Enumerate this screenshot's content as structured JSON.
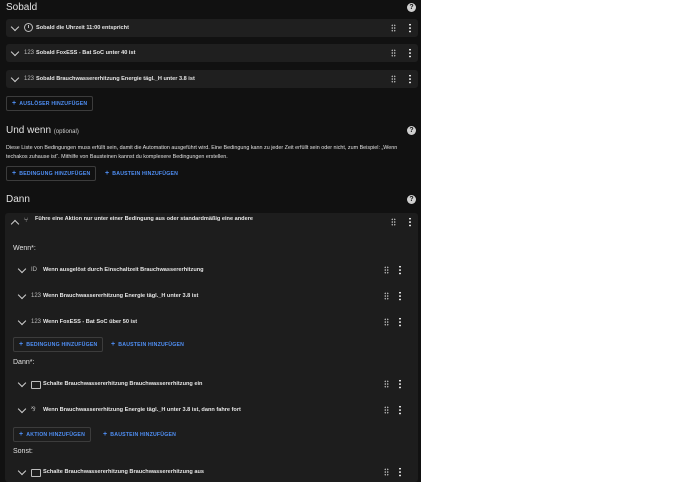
{
  "sobald": {
    "title": "Sobald",
    "help_icon": "?",
    "triggers": [
      {
        "icon": "clock-icon",
        "label": "Sobald die Uhrzeit 11:00 entspricht"
      },
      {
        "icon": "numeric-icon",
        "icon_text": "123",
        "label": "Sobald FoxESS - Bat SoC unter 40 ist"
      },
      {
        "icon": "numeric-icon",
        "icon_text": "123",
        "label": "Sobald Brauchwassererhitzung Energie tägl._H unter 3.8 ist"
      }
    ],
    "add_label": "AUSLÖSER HINZUFÜGEN"
  },
  "und_wenn": {
    "title": "Und wenn",
    "optional": "(optional)",
    "help_icon": "?",
    "description": "Diese Liste von Bedingungen muss erfüllt sein, damit die Automation ausgeführt wird. Eine Bedingung kann zu jeder Zeit erfüllt sein oder nicht, zum Beispiel: „Wenn techakos zuhause ist“. Mithilfe von Bausteinen kannst du komplexere Bedingungen erstellen.",
    "add_condition_label": "BEDINGUNG HINZUFÜGEN",
    "add_block_label": "BAUSTEIN HINZUFÜGEN"
  },
  "dann": {
    "title": "Dann",
    "help_icon": "?",
    "choose": {
      "label": "Führe eine Aktion nur unter einer Bedingung aus oder standardmäßig eine andere",
      "wenn_label": "Wenn*:",
      "conditions": [
        {
          "icon": "id-icon",
          "icon_text": "ID",
          "label": "Wenn ausgelöst durch Einschaltzeit Brauchwassererhitzung"
        },
        {
          "icon": "numeric-icon",
          "icon_text": "123",
          "label": "Wenn Brauchwassererhitzung Energie tägl._H unter 3.8 ist"
        },
        {
          "icon": "numeric-icon",
          "icon_text": "123",
          "label": "Wenn FoxESS - Bat SoC über 50 ist"
        }
      ],
      "add_condition_label": "BEDINGUNG HINZUFÜGEN",
      "add_block_label": "BAUSTEIN HINZUFÜGEN",
      "dann_label": "Dann*:",
      "actions": [
        {
          "icon": "toggle-icon",
          "label": "Schalte Brauchwassererhitzung Brauchwassererhitzung ein"
        },
        {
          "icon": "if-else-icon",
          "icon_text": "⅋",
          "label": "Wenn Brauchwassererhitzung Energie tägl._H unter 3.8 ist, dann fahre fort"
        }
      ],
      "add_action_label": "AKTION HINZUFÜGEN",
      "add_action_block_label": "BAUSTEIN HINZUFÜGEN",
      "sonst_label": "Sonst:",
      "else_actions": [
        {
          "icon": "toggle-icon",
          "label": "Schalte Brauchwassererhitzung Brauchwassererhitzung aus"
        }
      ]
    }
  },
  "plus": "+",
  "colors": {
    "panel": "#111111",
    "card": "#1f1f1f",
    "accent": "#4f8ff5"
  }
}
